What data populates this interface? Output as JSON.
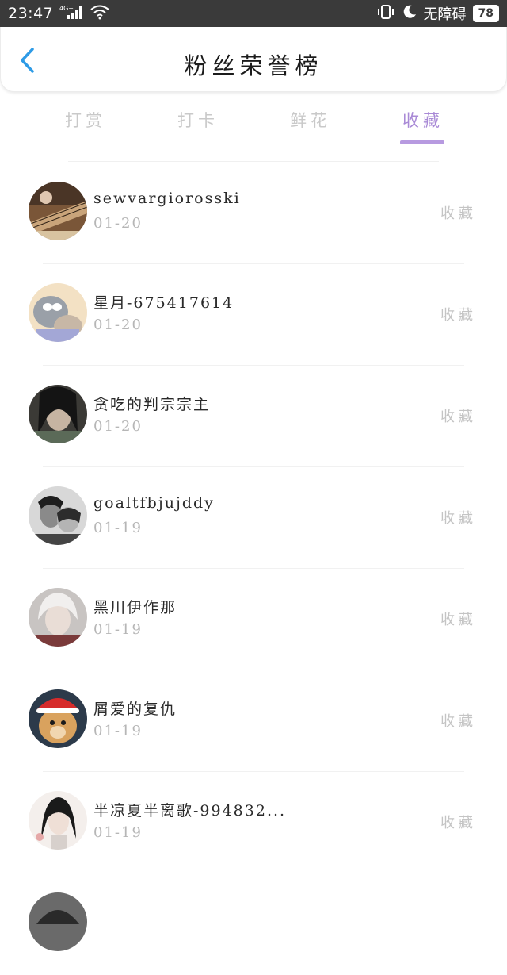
{
  "status_bar": {
    "time": "23:47",
    "network": "4G+",
    "dnd_label": "无障碍",
    "battery": "78"
  },
  "header": {
    "title": "粉丝荣誉榜"
  },
  "tabs": [
    {
      "label": "打赏",
      "active": false
    },
    {
      "label": "打卡",
      "active": false
    },
    {
      "label": "鲜花",
      "active": false
    },
    {
      "label": "收藏",
      "active": true
    }
  ],
  "colors": {
    "accent": "#a98ad6",
    "indicator": "#b79ae0",
    "status_bar_bg": "#3a3a3a",
    "muted_text": "#c4c4c4"
  },
  "fans": [
    {
      "name": "sewvargiorosski",
      "date": "01-20",
      "action": "收藏",
      "avatar": "guzheng-avatar"
    },
    {
      "name": "星月-675417614",
      "date": "01-20",
      "action": "收藏",
      "avatar": "cartoon-cat-avatar"
    },
    {
      "name": "贪吃的判宗宗主",
      "date": "01-20",
      "action": "收藏",
      "avatar": "dark-portrait-avatar"
    },
    {
      "name": "goaltfbjujddy",
      "date": "01-19",
      "action": "收藏",
      "avatar": "couple-bw-avatar"
    },
    {
      "name": "黑川伊作那",
      "date": "01-19",
      "action": "收藏",
      "avatar": "anime-silver-hair-avatar"
    },
    {
      "name": "屑爱的复仇",
      "date": "01-19",
      "action": "收藏",
      "avatar": "dog-santa-hat-avatar"
    },
    {
      "name": "半凉夏半离歌-994832...",
      "date": "01-19",
      "action": "收藏",
      "avatar": "ink-portrait-avatar"
    }
  ]
}
